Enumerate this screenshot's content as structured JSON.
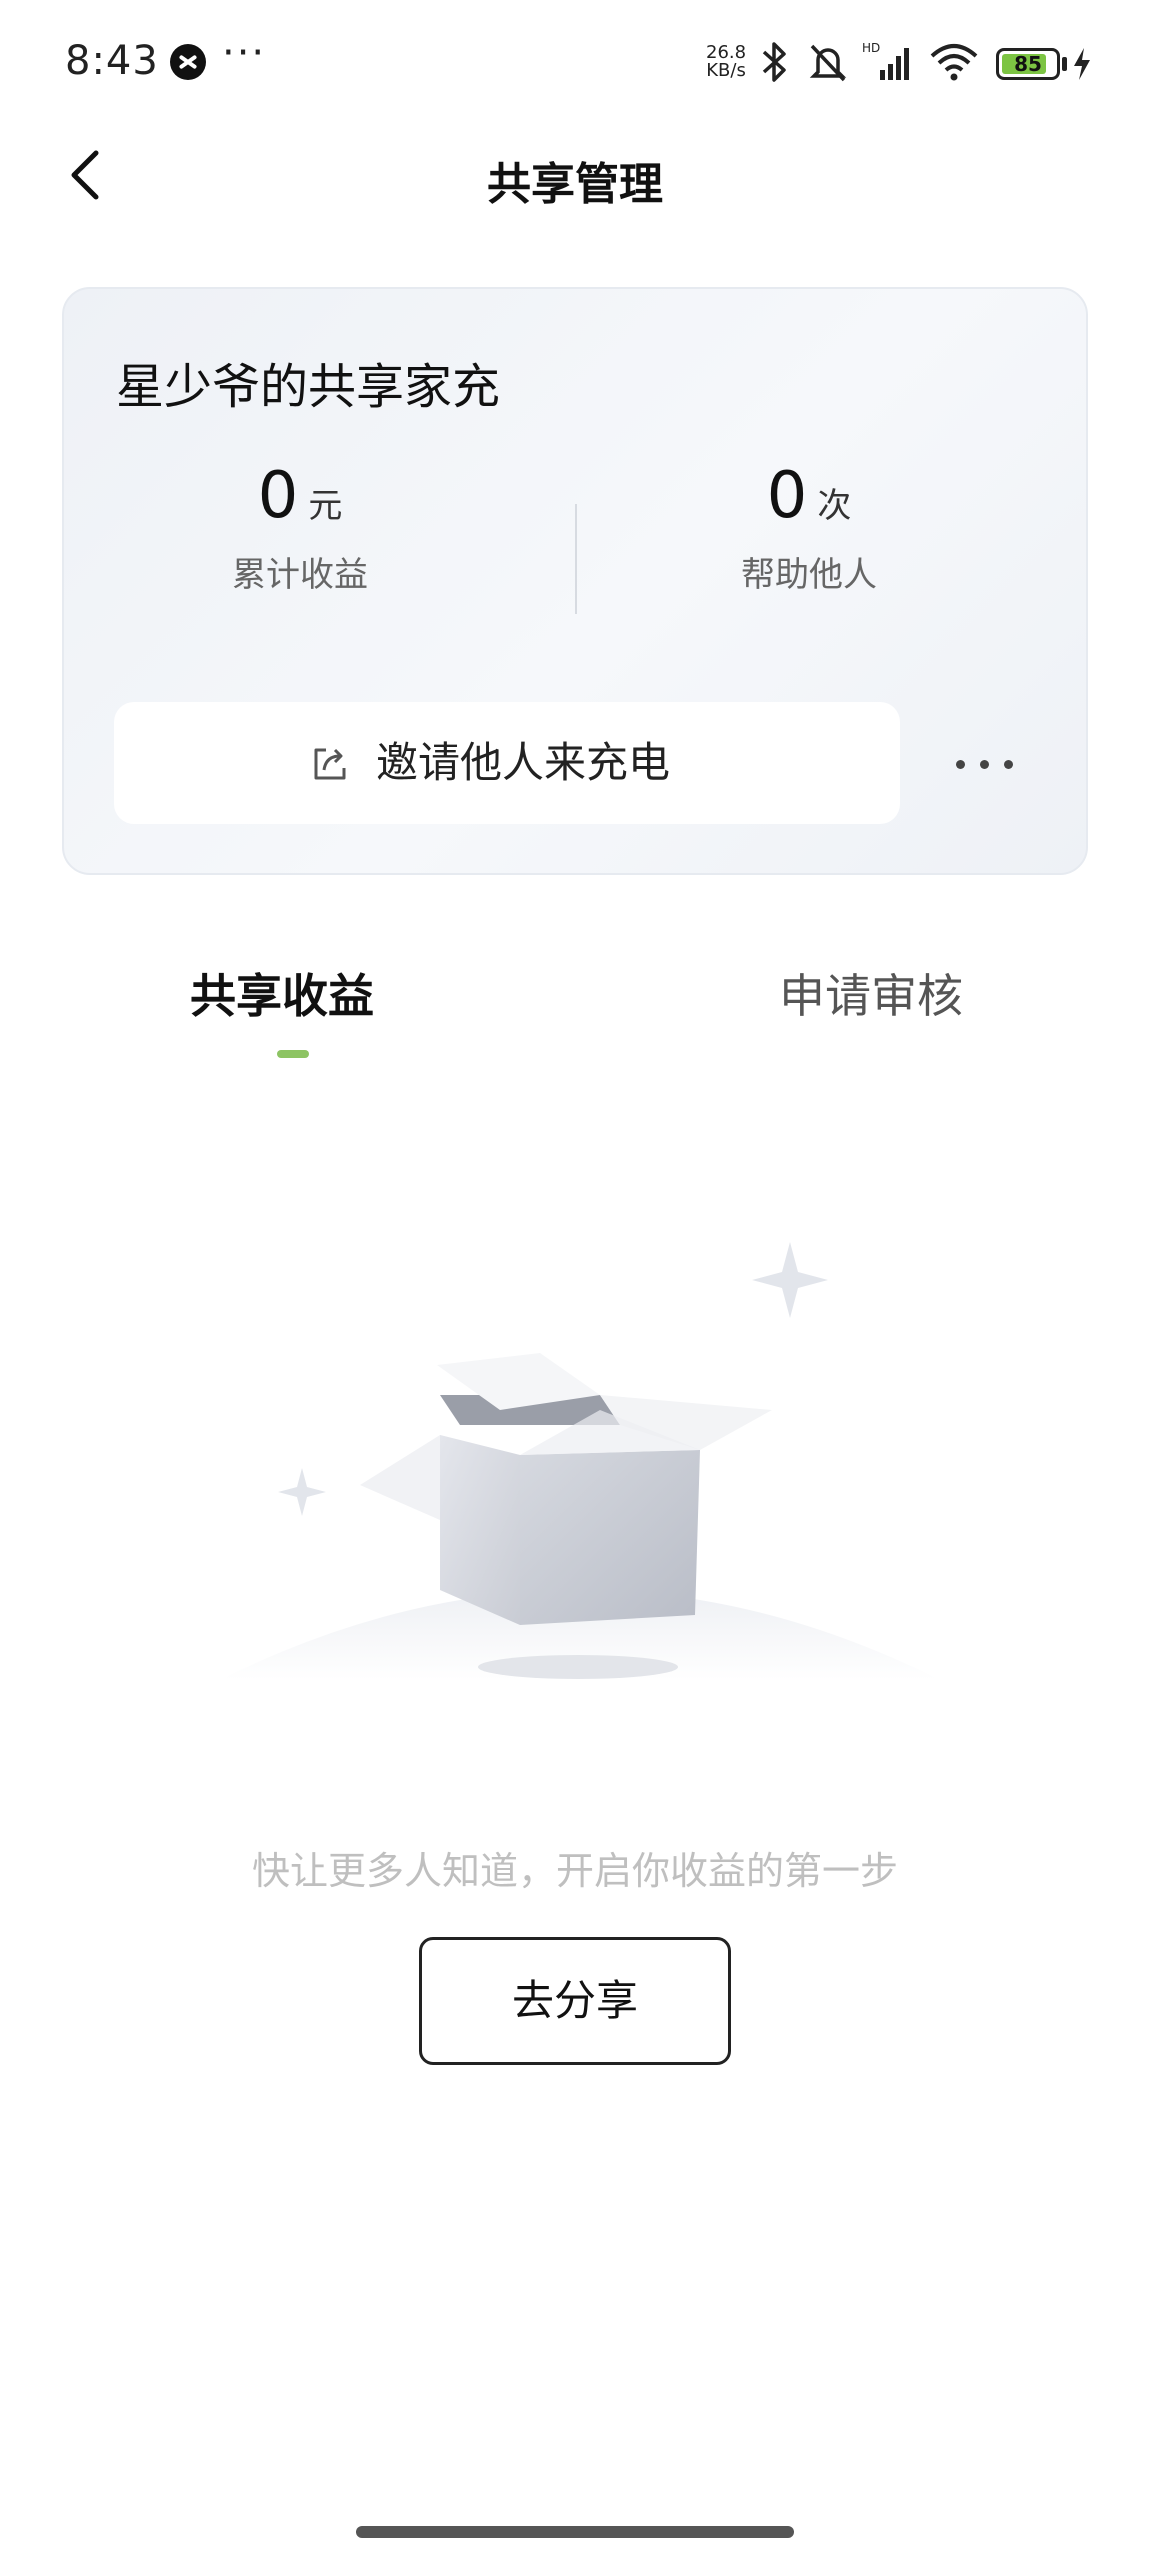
{
  "status_bar": {
    "time": "8:43",
    "more": "···",
    "net_speed_value": "26.8",
    "net_speed_unit": "KB/s",
    "battery": "85",
    "battery_level_percent": 85,
    "icons": [
      "bluetooth-icon",
      "mute-bell-icon",
      "signal-icon",
      "wifi-icon",
      "battery-icon",
      "charging-icon"
    ]
  },
  "header": {
    "title": "共享管理",
    "back_icon": "chevron-left-icon"
  },
  "card": {
    "title": "星少爷的共享家充",
    "earnings": {
      "value": "0",
      "unit": "元",
      "label": "累计收益"
    },
    "helps": {
      "value": "0",
      "unit": "次",
      "label": "帮助他人"
    },
    "invite_label": "邀请他人来充电",
    "invite_icon": "share-icon",
    "more_icon": "more-dots-icon"
  },
  "tabs": [
    {
      "label": "共享收益",
      "active": true
    },
    {
      "label": "申请审核",
      "active": false
    }
  ],
  "empty_state": {
    "illustration": "empty-box-icon",
    "message": "快让更多人知道，开启你收益的第一步",
    "button_label": "去分享"
  },
  "colors": {
    "accent": "#8dc463",
    "battery_green": "#7cc443",
    "card_bg": "#eef1f6",
    "muted_text": "#bfbfbf"
  }
}
